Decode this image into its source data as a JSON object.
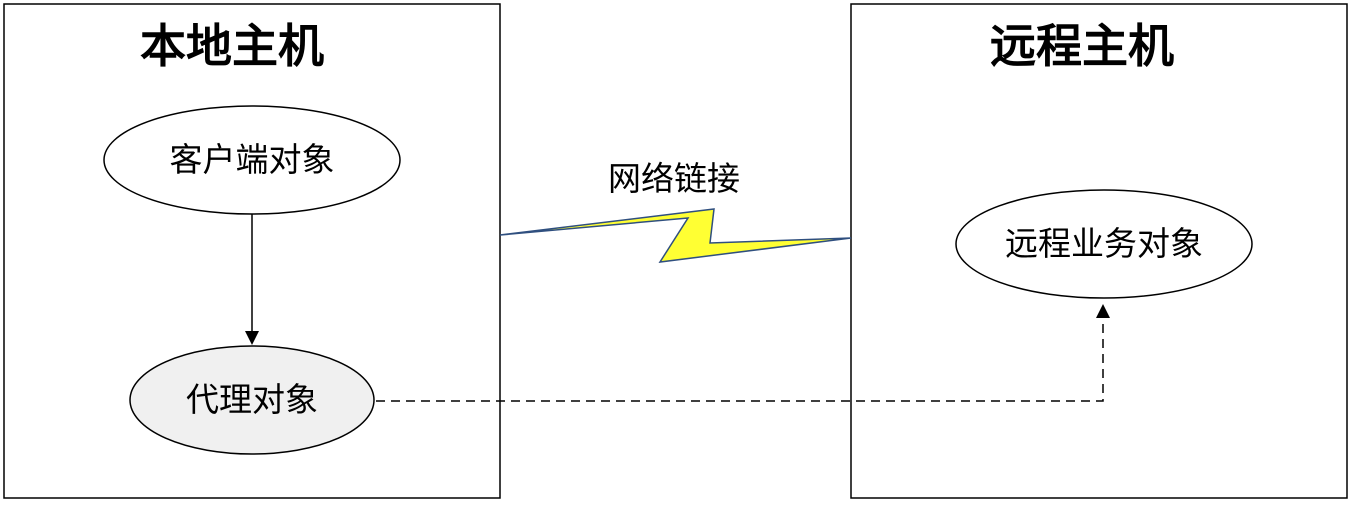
{
  "local_host": {
    "title": "本地主机",
    "client_object": "客户端对象",
    "proxy_object": "代理对象"
  },
  "remote_host": {
    "title": "远程主机",
    "service_object": "远程业务对象"
  },
  "network": {
    "label": "网络链接"
  },
  "colors": {
    "proxy_fill": "#f0f0f0",
    "node_fill": "#ffffff",
    "bolt_fill": "#ffff33",
    "bolt_stroke": "#2f4f7f"
  }
}
